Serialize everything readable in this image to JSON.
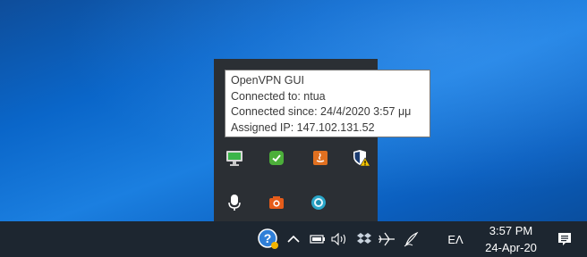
{
  "tooltip": {
    "line1": "OpenVPN GUI",
    "line2": "Connected to: ntua",
    "line3": "Connected since: 24/4/2020 3:57 μμ",
    "line4": "Assigned IP: 147.102.131.52"
  },
  "overflow_icons": [
    "openvpn-connected-icon",
    "security-check-icon",
    "java-update-icon",
    "windows-security-warning-icon",
    "microphone-icon",
    "camera-app-icon",
    "browser-app-icon"
  ],
  "taskbar": {
    "language": "ΕΛ",
    "time": "3:57 PM",
    "date": "24-Apr-20"
  },
  "colors": {
    "taskbar_bg": "#1d2630",
    "overflow_bg": "#2b2f34",
    "accent_green": "#3cb54a",
    "accent_orange": "#e07020"
  }
}
